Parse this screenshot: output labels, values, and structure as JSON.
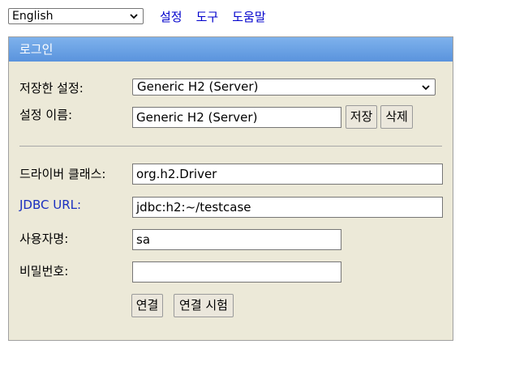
{
  "toolbar": {
    "language_selected": "English",
    "links": [
      "설정",
      "도구",
      "도움말"
    ]
  },
  "login": {
    "title": "로그인",
    "saved_settings_label": "저장한 설정:",
    "saved_settings_value": "Generic H2 (Server)",
    "setting_name_label": "설정 이름:",
    "setting_name_value": "Generic H2 (Server)",
    "save_button": "저장",
    "delete_button": "삭제",
    "driver_class_label": "드라이버 클래스:",
    "driver_class_value": "org.h2.Driver",
    "jdbc_url_label": "JDBC URL:",
    "jdbc_url_value": "jdbc:h2:~/testcase",
    "username_label": "사용자명:",
    "username_value": "sa",
    "password_label": "비밀번호:",
    "password_value": "",
    "connect_button": "연결",
    "test_connection_button": "연결 시험"
  },
  "colors": {
    "panel_background": "#ece9d8",
    "header_gradient_top": "#7eb2ec",
    "header_gradient_bottom": "#5a93dd",
    "link_color": "#0000cc"
  },
  "icons": {
    "dropdown": "chevron-down-icon"
  }
}
